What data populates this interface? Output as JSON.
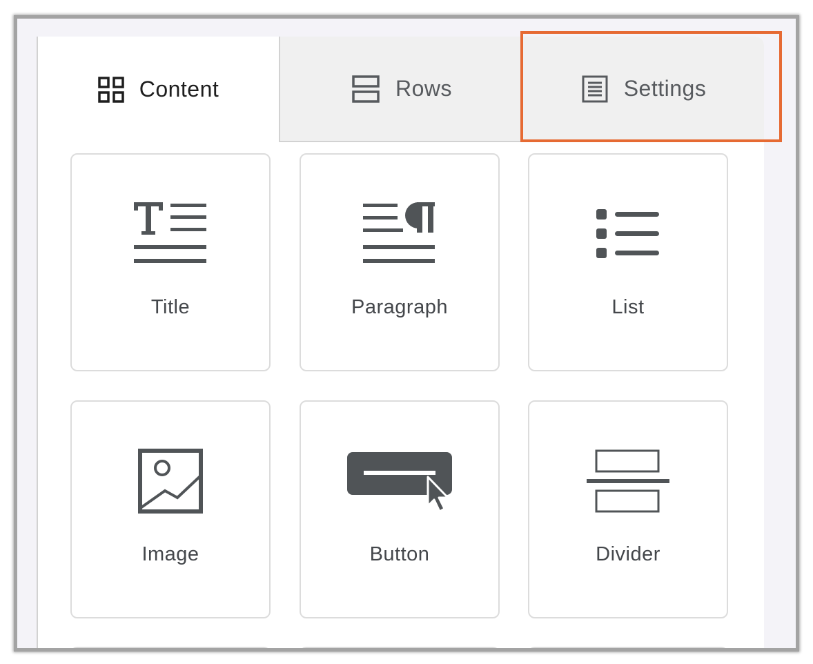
{
  "tabs": [
    {
      "label": "Content",
      "icon": "grid-icon",
      "active": true
    },
    {
      "label": "Rows",
      "icon": "rows-icon",
      "active": false
    },
    {
      "label": "Settings",
      "icon": "settings-doc-icon",
      "active": false,
      "highlighted": true
    }
  ],
  "blocks": [
    {
      "label": "Title",
      "icon": "title-icon"
    },
    {
      "label": "Paragraph",
      "icon": "paragraph-icon"
    },
    {
      "label": "List",
      "icon": "list-icon"
    },
    {
      "label": "Image",
      "icon": "image-icon"
    },
    {
      "label": "Button",
      "icon": "button-icon"
    },
    {
      "label": "Divider",
      "icon": "divider-icon"
    }
  ],
  "colors": {
    "icon": "#505457",
    "highlight": "#e66a33",
    "inactive_tab_bg": "#f0f0f0"
  }
}
